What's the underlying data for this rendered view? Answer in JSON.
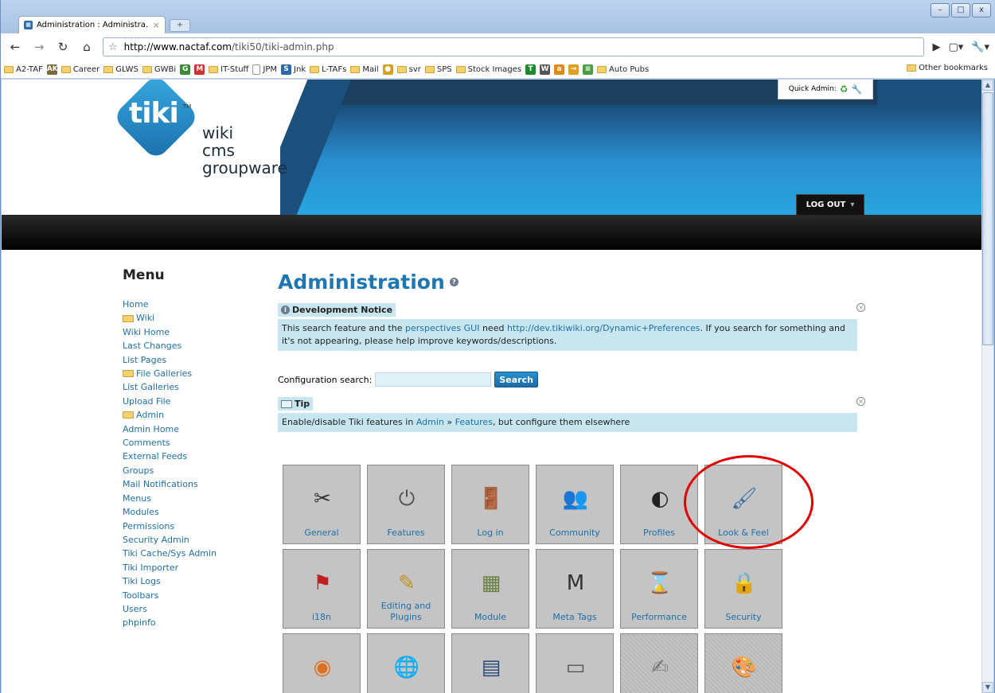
{
  "browser": {
    "tab_title": "Administration : Administra...",
    "tab_close": "×",
    "new_tab": "+",
    "url_domain": "http://www.nactaf.com",
    "url_path": "/tiki50/tiki-admin.php",
    "window_buttons": [
      "–",
      "□",
      "x"
    ],
    "bookmarks": [
      {
        "label": "A2-TAF",
        "type": "folder"
      },
      {
        "label": "",
        "type": "glyph",
        "glyph": "AKO",
        "color": "#7a6a3a"
      },
      {
        "label": "Career",
        "type": "folder"
      },
      {
        "label": "GLWS",
        "type": "folder"
      },
      {
        "label": "GWBi",
        "type": "folder"
      },
      {
        "label": "",
        "type": "glyph",
        "glyph": "G",
        "color": "#3a8a3a"
      },
      {
        "label": "",
        "type": "glyph",
        "glyph": "M",
        "color": "#d03030"
      },
      {
        "label": "IT-Stuff",
        "type": "folder"
      },
      {
        "label": "JPM",
        "type": "page"
      },
      {
        "label": "Jnk",
        "type": "glyph",
        "glyph": "S",
        "color": "#2a6ab0"
      },
      {
        "label": "L-TAFs",
        "type": "folder"
      },
      {
        "label": "Mail",
        "type": "folder"
      },
      {
        "label": "",
        "type": "glyph",
        "glyph": "●",
        "color": "#d8a020"
      },
      {
        "label": "svr",
        "type": "folder"
      },
      {
        "label": "SPS",
        "type": "folder"
      },
      {
        "label": "Stock Images",
        "type": "folder"
      },
      {
        "label": "",
        "type": "glyph",
        "glyph": "T",
        "color": "#1e8a2e"
      },
      {
        "label": "",
        "type": "glyph",
        "glyph": "W",
        "color": "#555555"
      },
      {
        "label": "",
        "type": "glyph",
        "glyph": "a",
        "color": "#e08a10"
      },
      {
        "label": "",
        "type": "glyph",
        "glyph": "→",
        "color": "#e0a020"
      },
      {
        "label": "",
        "type": "glyph",
        "glyph": "≡",
        "color": "#4aa040"
      },
      {
        "label": "Auto Pubs",
        "type": "folder"
      }
    ],
    "other_bookmarks": "Other bookmarks"
  },
  "header": {
    "logo_text": "tiki",
    "tm": "TM",
    "tagline": [
      "wiki",
      "cms",
      "groupware"
    ],
    "quick_admin": "Quick Admin:",
    "logout": "LOG OUT"
  },
  "menu": {
    "title": "Menu",
    "items": [
      {
        "label": "Home",
        "section": false
      },
      {
        "label": "Wiki",
        "section": true
      },
      {
        "label": "Wiki Home",
        "section": false
      },
      {
        "label": "Last Changes",
        "section": false
      },
      {
        "label": "List Pages",
        "section": false
      },
      {
        "label": "File Galleries",
        "section": true
      },
      {
        "label": "List Galleries",
        "section": false
      },
      {
        "label": "Upload File",
        "section": false
      },
      {
        "label": "Admin",
        "section": true
      },
      {
        "label": "Admin Home",
        "section": false
      },
      {
        "label": "Comments",
        "section": false
      },
      {
        "label": "External Feeds",
        "section": false
      },
      {
        "label": "Groups",
        "section": false
      },
      {
        "label": "Mail Notifications",
        "section": false
      },
      {
        "label": "Menus",
        "section": false
      },
      {
        "label": "Modules",
        "section": false
      },
      {
        "label": "Permissions",
        "section": false
      },
      {
        "label": "Security Admin",
        "section": false
      },
      {
        "label": "Tiki Cache/Sys Admin",
        "section": false
      },
      {
        "label": "Tiki Importer",
        "section": false
      },
      {
        "label": "Tiki Logs",
        "section": false
      },
      {
        "label": "Toolbars",
        "section": false
      },
      {
        "label": "Users",
        "section": false
      },
      {
        "label": "phpinfo",
        "section": false
      }
    ]
  },
  "main": {
    "title": "Administration",
    "dev_notice": {
      "heading": "Development Notice",
      "text_1": "This search feature and the ",
      "link_1": "perspectives GUI",
      "text_2": " need ",
      "link_2": "http://dev.tikiwiki.org/Dynamic+Preferences",
      "text_3": ". If you search for something and it's not appearing, please help improve keywords/descriptions."
    },
    "search": {
      "label": "Configuration search:",
      "value": "",
      "button": "Search"
    },
    "tip": {
      "heading": "Tip",
      "text_1": "Enable/disable Tiki features in ",
      "link_1": "Admin",
      "sep": " » ",
      "link_2": "Features",
      "text_2": ", but configure them elsewhere"
    },
    "tiles": [
      {
        "label": "General",
        "icon": "wrench-screwdriver-icon",
        "glyph": "✂",
        "color": "#333"
      },
      {
        "label": "Features",
        "icon": "power-icon",
        "glyph": "⏻",
        "color": "#555"
      },
      {
        "label": "Log in",
        "icon": "door-icon",
        "glyph": "🚪",
        "color": "#a06020"
      },
      {
        "label": "Community",
        "icon": "people-icon",
        "glyph": "👥",
        "color": "#c07030"
      },
      {
        "label": "Profiles",
        "icon": "profile-icon",
        "glyph": "◐",
        "color": "#222"
      },
      {
        "label": "Look & Feel",
        "icon": "paint-screen-icon",
        "glyph": "🖌",
        "color": "#3a6aa0"
      },
      {
        "label": "i18n",
        "icon": "flag-icon",
        "glyph": "⚑",
        "color": "#c02020"
      },
      {
        "label": "Editing and Plugins",
        "icon": "notepad-pencil-icon",
        "glyph": "✎",
        "color": "#c09020"
      },
      {
        "label": "Module",
        "icon": "module-icon",
        "glyph": "▦",
        "color": "#6a8040"
      },
      {
        "label": "Meta Tags",
        "icon": "tag-card-icon",
        "glyph": "M",
        "color": "#333"
      },
      {
        "label": "Performance",
        "icon": "hourglass-icon",
        "glyph": "⌛",
        "color": "#a05020"
      },
      {
        "label": "Security",
        "icon": "padlock-icon",
        "glyph": "🔒",
        "color": "#d0a020"
      },
      {
        "label": "",
        "icon": "rss-icon",
        "glyph": "◉",
        "color": "#e07020"
      },
      {
        "label": "",
        "icon": "globe-icon",
        "glyph": "🌐",
        "color": "#3070b0"
      },
      {
        "label": "",
        "icon": "document-icon",
        "glyph": "▤",
        "color": "#2a4a7a"
      },
      {
        "label": "",
        "icon": "card-file-icon",
        "glyph": "▭",
        "color": "#555"
      },
      {
        "label": "",
        "icon": "edit-page-icon",
        "glyph": "✍",
        "color": "#777"
      },
      {
        "label": "",
        "icon": "palette-icon",
        "glyph": "🎨",
        "color": "#8a6a40"
      }
    ]
  },
  "colors": {
    "link": "#1e6fa8",
    "title": "#1e77b0",
    "notice_bg": "#c7e6f0",
    "highlight_circle": "#e00000"
  }
}
